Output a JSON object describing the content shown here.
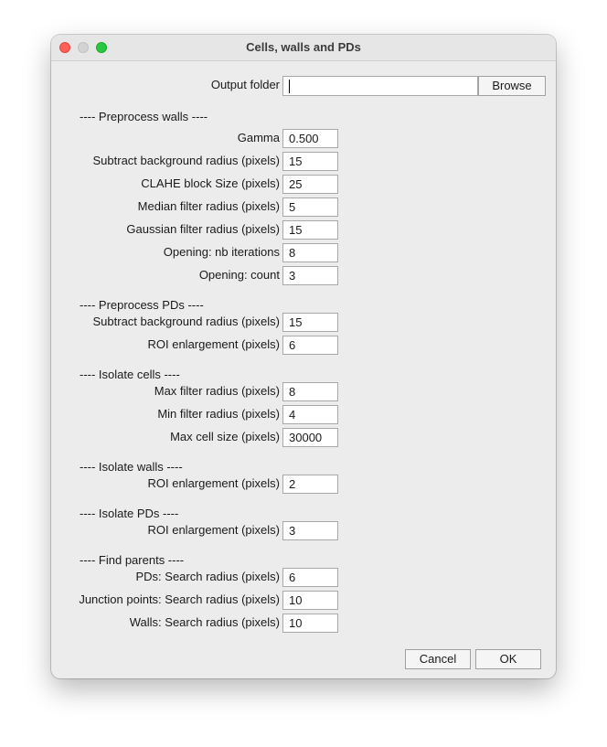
{
  "window": {
    "title": "Cells, walls and PDs"
  },
  "output": {
    "label": "Output folder",
    "value": "",
    "browse_label": "Browse"
  },
  "sections": {
    "preprocess_walls": "---- Preprocess walls ----",
    "preprocess_pds": "---- Preprocess PDs ----",
    "isolate_cells": "---- Isolate cells ----",
    "isolate_walls": "---- Isolate walls ----",
    "isolate_pds": "---- Isolate PDs ----",
    "find_parents": "---- Find parents ----"
  },
  "preprocess_walls": {
    "gamma_label": "Gamma",
    "gamma_value": "0.500",
    "subtract_bg_label": "Subtract background radius (pixels)",
    "subtract_bg_value": "15",
    "clahe_label": "CLAHE block Size (pixels)",
    "clahe_value": "25",
    "median_label": "Median filter radius (pixels)",
    "median_value": "5",
    "gaussian_label": "Gaussian filter radius (pixels)",
    "gaussian_value": "15",
    "opening_iter_label": "Opening: nb iterations",
    "opening_iter_value": "8",
    "opening_count_label": "Opening: count",
    "opening_count_value": "3"
  },
  "preprocess_pds": {
    "subtract_bg_label": "Subtract background radius (pixels)",
    "subtract_bg_value": "15",
    "roi_enlarge_label": "ROI enlargement (pixels)",
    "roi_enlarge_value": "6"
  },
  "isolate_cells": {
    "max_filter_label": "Max filter radius (pixels)",
    "max_filter_value": "8",
    "min_filter_label": "Min filter radius (pixels)",
    "min_filter_value": "4",
    "max_cell_label": "Max cell size (pixels)",
    "max_cell_value": "30000"
  },
  "isolate_walls": {
    "roi_enlarge_label": "ROI enlargement (pixels)",
    "roi_enlarge_value": "2"
  },
  "isolate_pds": {
    "roi_enlarge_label": "ROI enlargement (pixels)",
    "roi_enlarge_value": "3"
  },
  "find_parents": {
    "pds_radius_label": "PDs: Search radius (pixels)",
    "pds_radius_value": "6",
    "junction_radius_label": "Junction points: Search radius (pixels)",
    "junction_radius_value": "10",
    "walls_radius_label": "Walls: Search radius (pixels)",
    "walls_radius_value": "10"
  },
  "buttons": {
    "cancel_label": "Cancel",
    "ok_label": "OK"
  }
}
